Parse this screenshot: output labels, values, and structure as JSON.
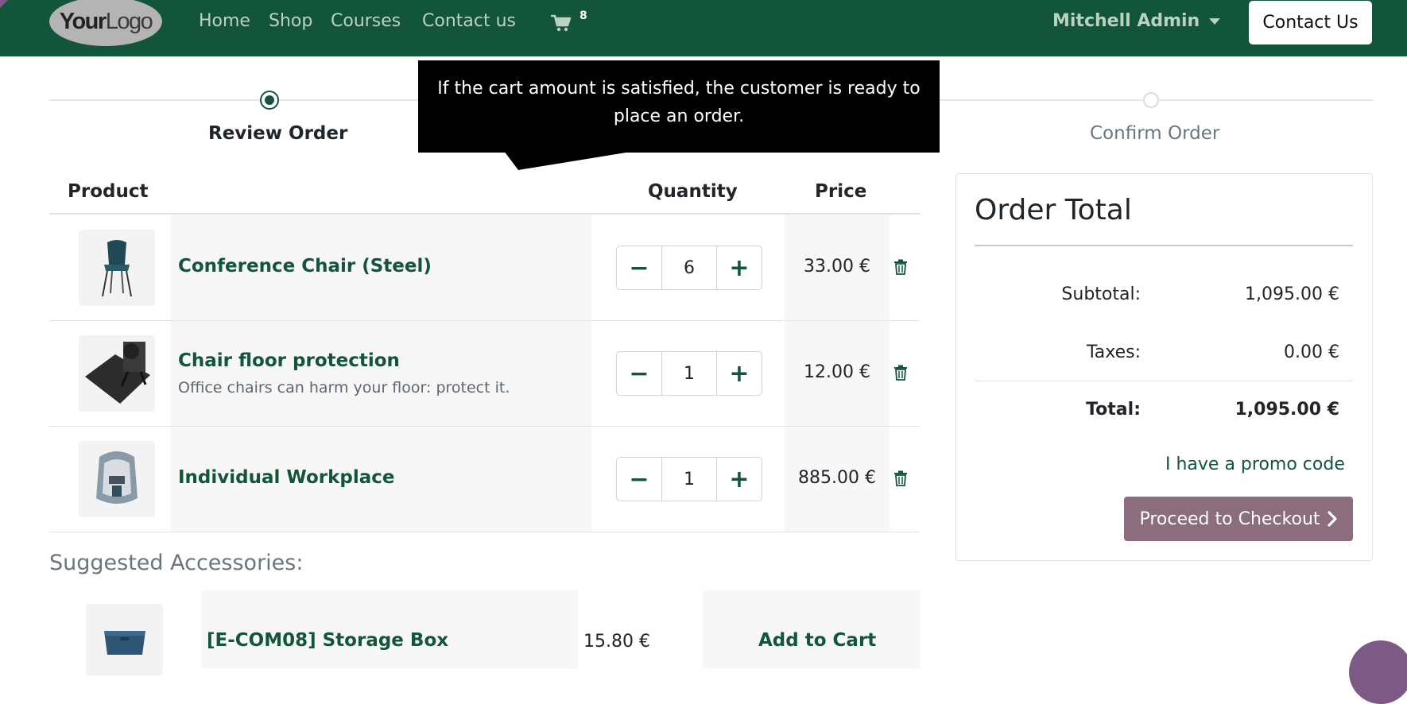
{
  "navbar": {
    "logo": {
      "part1": "Your",
      "part2": "Logo"
    },
    "links": [
      "Home",
      "Shop",
      "Courses",
      "Contact us"
    ],
    "cart_count": "8",
    "user_name": "Mitchell Admin",
    "contact_button": "Contact Us"
  },
  "progress": {
    "steps": [
      {
        "label": "Review Order",
        "state": "active"
      },
      {
        "label": "Confirm Order",
        "state": "inactive"
      }
    ]
  },
  "tooltip": {
    "text": "If the cart amount is satisfied, the customer is ready to place an order."
  },
  "cart": {
    "headers": {
      "product": "Product",
      "quantity": "Quantity",
      "price": "Price"
    },
    "rows": [
      {
        "name": "Conference Chair (Steel)",
        "description": "",
        "quantity": "6",
        "price": "33.00 €",
        "image_icon": "chair-icon"
      },
      {
        "name": "Chair floor protection",
        "description": "Office chairs can harm your floor: protect it.",
        "quantity": "1",
        "price": "12.00 €",
        "image_icon": "floor-mat-icon"
      },
      {
        "name": "Individual Workplace",
        "description": "",
        "quantity": "1",
        "price": "885.00 €",
        "image_icon": "workpod-icon"
      }
    ]
  },
  "order_total": {
    "title": "Order Total",
    "subtotal_label": "Subtotal:",
    "subtotal_value": "1,095.00 €",
    "taxes_label": "Taxes:",
    "taxes_value": "0.00 €",
    "total_label": "Total:",
    "total_value": "1,095.00 €",
    "promo_link": "I have a promo code",
    "checkout_button": "Proceed to Checkout"
  },
  "suggested": {
    "title": "Suggested Accessories:",
    "items": [
      {
        "name": "[E-COM08] Storage Box",
        "price": "15.80 €",
        "add_label": "Add to Cart",
        "image_icon": "storage-box-icon"
      }
    ]
  },
  "colors": {
    "brand_green": "#12553a",
    "checkout_mauve": "#8b6d7e",
    "tooltip_bg": "#000000"
  }
}
